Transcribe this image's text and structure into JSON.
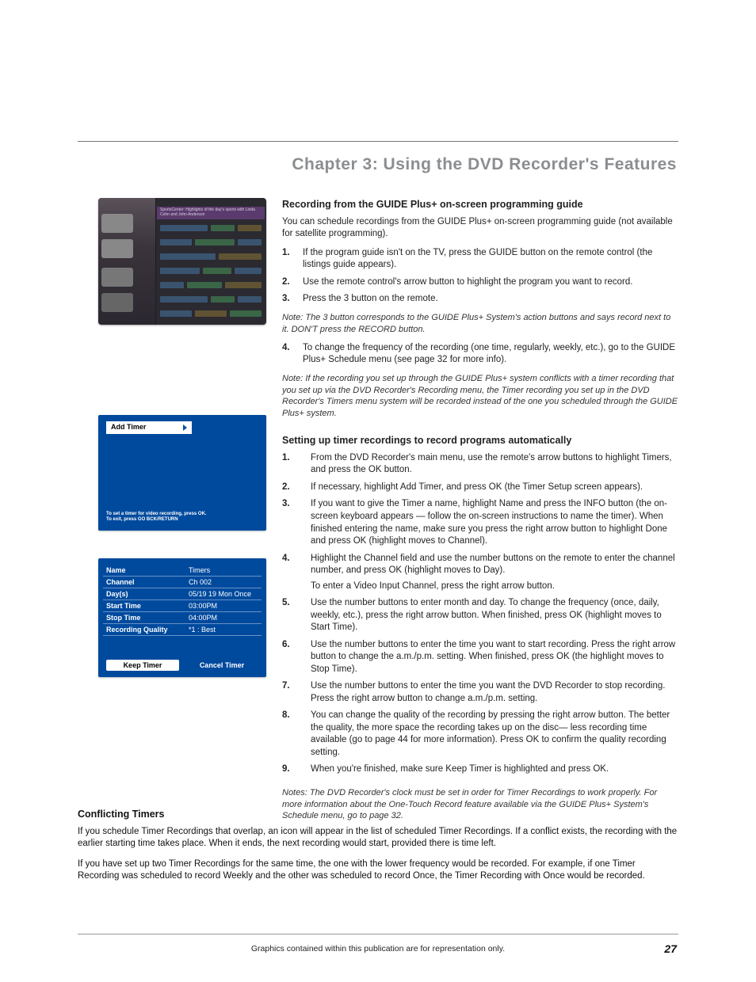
{
  "chapter_title": "Chapter 3: Using the DVD Recorder's Features",
  "fig1": {
    "head_text": "SportsCenter: Highlights of the day's sports with Linda Cohn and John Anderson"
  },
  "fig2": {
    "label": "Add Timer",
    "hint_line1": "To set a timer for video recording, press OK.",
    "hint_line2": "To exit, press GO BCK/RETURN"
  },
  "fig3": {
    "rows": {
      "name_label": "Name",
      "name_value": "Timers",
      "channel_label": "Channel",
      "channel_value": "Ch 002",
      "days_label": "Day(s)",
      "days_value": "05/19 19 Mon Once",
      "start_label": "Start Time",
      "start_value": "03:00PM",
      "stop_label": "Stop Time",
      "stop_value": "04:00PM",
      "quality_label": "Recording Quality",
      "quality_value": "*1 : Best"
    },
    "keep": "Keep Timer",
    "cancel": "Cancel Timer"
  },
  "section1": {
    "heading": "Recording from the GUIDE Plus+ on-screen programming guide",
    "intro": "You can schedule recordings from the GUIDE Plus+ on-screen programming guide (not available for satellite programming).",
    "step1": "If the program guide isn't on the TV, press the GUIDE button on the remote control (the listings guide appears).",
    "step2": "Use the remote control's arrow button to highlight the program you want to record.",
    "step3": "Press the 3 button on the remote.",
    "note1": "Note: The 3 button corresponds to the GUIDE Plus+ System's action buttons and says record next to it. DON'T press the RECORD button.",
    "step4": "To change the frequency of the recording (one time, regularly, weekly, etc.), go to the GUIDE Plus+ Schedule menu (see page 32 for more info).",
    "note2": "Note: If the recording you set up through the GUIDE Plus+ system conflicts with a timer recording that you set up via the DVD Recorder's Recording menu, the Timer recording you set up in the DVD Recorder's Timers menu system will be recorded instead of the one you scheduled through the GUIDE Plus+ system."
  },
  "section2": {
    "heading": "Setting up timer recordings to record programs automatically",
    "step1": "From the DVD Recorder's main menu, use the remote's arrow buttons to highlight Timers, and press the OK button.",
    "step2": "If necessary, highlight Add Timer, and press OK (the Timer Setup screen appears).",
    "step3": "If you want to give the Timer a name, highlight Name and press the INFO button (the on-screen keyboard appears — follow the on-screen instructions to name the timer). When finished entering the name, make sure you press the right arrow button to highlight Done and press OK (highlight moves to Channel).",
    "step4": "Highlight the Channel field and use the number buttons on the remote to enter the channel number, and press OK (highlight moves to Day).",
    "step4b": "To enter a Video Input Channel, press the right arrow button.",
    "step5": "Use the number buttons to enter month and day. To change the frequency (once, daily, weekly, etc.), press the right arrow button. When finished, press OK (highlight moves to Start Time).",
    "step6": "Use the number buttons to enter the time you want to start recording. Press the right arrow button to change the a.m./p.m. setting. When finished, press OK (the highlight moves to Stop Time).",
    "step7": "Use the number buttons to enter the time you want the DVD Recorder to stop recording. Press the right arrow button to change a.m./p.m. setting.",
    "step8": "You can change the quality of the recording by pressing the right arrow button. The better the quality, the more space the recording takes up on the disc— less recording time available (go to page 44 for more information). Press OK to confirm the quality recording setting.",
    "step9": "When you're finished, make sure Keep Timer is highlighted and press OK.",
    "note": "Notes: The DVD Recorder's clock must be set in order for Timer Recordings to work properly. For more information about the One-Touch Record feature available via the GUIDE Plus+ System's Schedule menu, go to page 32."
  },
  "section3": {
    "heading": "Conflicting Timers",
    "p1": "If you schedule Timer Recordings that overlap, an icon will appear in the list of scheduled Timer Recordings. If a conflict exists, the recording with the earlier starting time takes place. When it ends, the next recording would start, provided there is time left.",
    "p2": "If you have set up two Timer Recordings for the same time, the one with the lower frequency would be recorded. For example, if one Timer Recording was scheduled to record Weekly and the other was scheduled to record Once, the Timer Recording with Once would be recorded."
  },
  "footer_text": "Graphics contained within this publication are for representation only.",
  "page_number": "27"
}
